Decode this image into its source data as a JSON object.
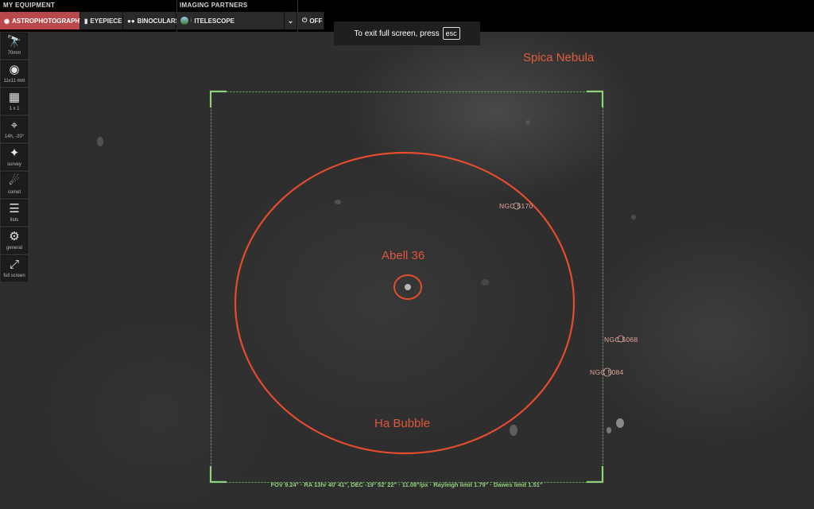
{
  "topbar": {
    "my_equipment": "MY EQUIPMENT",
    "imaging_partners": "IMAGING PARTNERS",
    "tabs": [
      {
        "label": "ASTROPHOTOGRAPHY",
        "icon": "camera-icon",
        "active": true
      },
      {
        "label": "EYEPIECE",
        "icon": "eyepiece-icon",
        "active": false
      },
      {
        "label": "BINOCULARS",
        "icon": "binoculars-icon",
        "active": false
      }
    ],
    "partner": {
      "prefix": "i",
      "label": "ITELESCOPE",
      "icon": "globe-icon"
    },
    "power_label": "OFF"
  },
  "toast": {
    "text": "To exit full screen, press",
    "key": "esc"
  },
  "sidebar": {
    "items": [
      {
        "label": "70mm",
        "icon": "telescope-icon"
      },
      {
        "label": "11x11 mm",
        "icon": "camera-icon"
      },
      {
        "label": "1 x 1",
        "icon": "grid-icon"
      },
      {
        "label": "14h, -20°",
        "icon": "crosshair-icon"
      },
      {
        "label": "survey",
        "icon": "satellite-icon"
      },
      {
        "label": "comet",
        "icon": "comet-icon"
      },
      {
        "label": "lists",
        "icon": "list-icon"
      },
      {
        "label": "general",
        "icon": "gear-icon"
      },
      {
        "label": "full screen",
        "icon": "fullscreen-icon"
      }
    ]
  },
  "sky": {
    "labels": {
      "spica": "Spica Nebula",
      "abell": "Abell 36",
      "habubble": "Ha Bubble"
    },
    "objects": [
      "NGC 5170",
      "NGC 5068",
      "NGC 5084"
    ],
    "fov_info": "FOV 9.24° · RA 13hr 40' 41\", DEC -19° 52' 22\" · 11.08\"/px · Rayleigh limit 1.79\"  · Dawes limit 1.51\""
  },
  "colors": {
    "accent": "#b8484a",
    "overlay_red": "#e0563a",
    "frame_green": "#8fd27c"
  }
}
